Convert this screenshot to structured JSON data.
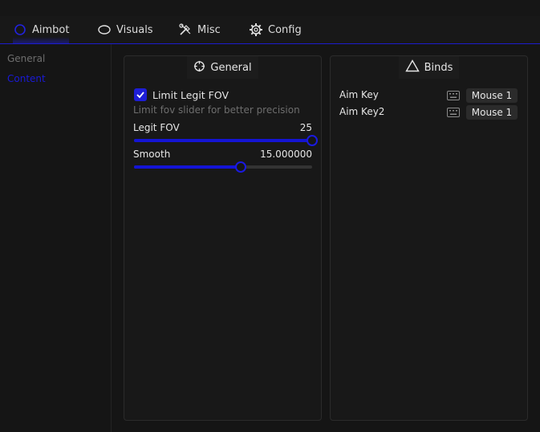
{
  "tabs": [
    {
      "label": "Aimbot",
      "icon": "crosshair-icon",
      "active": true
    },
    {
      "label": "Visuals",
      "icon": "eye-icon",
      "active": false
    },
    {
      "label": "Misc",
      "icon": "tools-icon",
      "active": false
    },
    {
      "label": "Config",
      "icon": "gear-icon",
      "active": false
    }
  ],
  "sidebar": {
    "items": [
      {
        "label": "General",
        "active": false
      },
      {
        "label": "Content",
        "active": true
      }
    ]
  },
  "general_panel": {
    "title": "General",
    "icon": "crosshair-icon",
    "limit_fov": {
      "label": "Limit Legit FOV",
      "checked": true,
      "hint": "Limit fov slider for better precision"
    },
    "legit_fov": {
      "label": "Legit FOV",
      "value": "25",
      "fraction": 1.0
    },
    "smooth": {
      "label": "Smooth",
      "value": "15.000000",
      "fraction": 0.6
    }
  },
  "binds_panel": {
    "title": "Binds",
    "icon": "triangle-icon",
    "binds": [
      {
        "label": "Aim Key",
        "key": "Mouse 1"
      },
      {
        "label": "Aim Key2",
        "key": "Mouse 1"
      }
    ]
  },
  "colors": {
    "accent": "#1414d4",
    "background": "#151515",
    "panel": "#181818"
  }
}
